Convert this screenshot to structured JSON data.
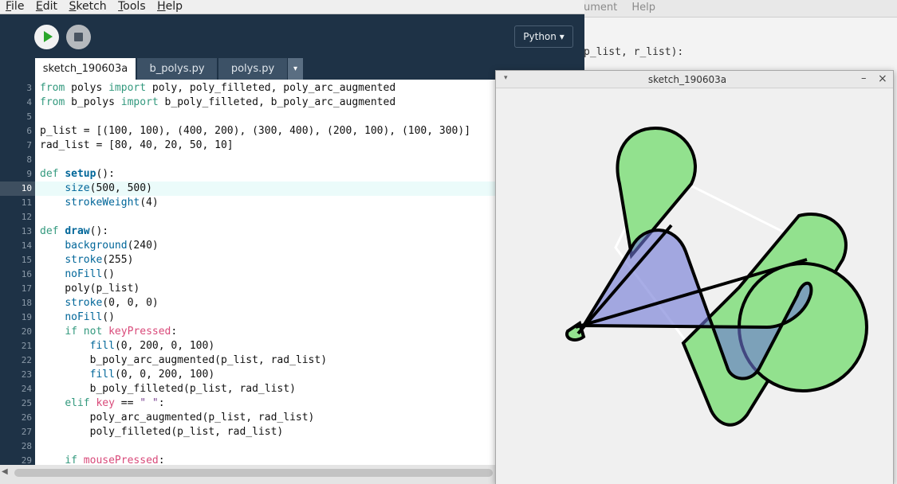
{
  "menu": {
    "file": "File",
    "edit": "Edit",
    "sketch": "Sketch",
    "tools": "Tools",
    "help": "Help"
  },
  "background_window": {
    "menu_items": [
      "ument",
      "Help"
    ],
    "code_fragment": "p_list, r_list):"
  },
  "toolbar": {
    "run_icon": "play-icon",
    "stop_icon": "stop-icon",
    "mode_label": "Python ▾"
  },
  "tabs": {
    "items": [
      "sketch_190603a",
      "b_polys.py",
      "polys.py"
    ],
    "active": 0,
    "overflow_icon": "▾"
  },
  "editor": {
    "lines": [
      {
        "n": "3",
        "text": "from polys import poly, poly_filleted, poly_arc_augmented"
      },
      {
        "n": "4",
        "text": "from b_polys import b_poly_filleted, b_poly_arc_augmented"
      },
      {
        "n": "5",
        "text": ""
      },
      {
        "n": "6",
        "text": "p_list = [(100, 100), (400, 200), (300, 400), (200, 100), (100, 300)]"
      },
      {
        "n": "7",
        "text": "rad_list = [80, 40, 20, 50, 10]"
      },
      {
        "n": "8",
        "text": ""
      },
      {
        "n": "9",
        "text": "def setup():"
      },
      {
        "n": "10",
        "text": "    size(500, 500)"
      },
      {
        "n": "11",
        "text": "    strokeWeight(4)"
      },
      {
        "n": "12",
        "text": ""
      },
      {
        "n": "13",
        "text": "def draw():"
      },
      {
        "n": "14",
        "text": "    background(240)"
      },
      {
        "n": "15",
        "text": "    stroke(255)"
      },
      {
        "n": "16",
        "text": "    noFill()"
      },
      {
        "n": "17",
        "text": "    poly(p_list)"
      },
      {
        "n": "18",
        "text": "    stroke(0, 0, 0)"
      },
      {
        "n": "19",
        "text": "    noFill()"
      },
      {
        "n": "20",
        "text": "    if not keyPressed:"
      },
      {
        "n": "21",
        "text": "        fill(0, 200, 0, 100)"
      },
      {
        "n": "22",
        "text": "        b_poly_arc_augmented(p_list, rad_list)"
      },
      {
        "n": "23",
        "text": "        fill(0, 0, 200, 100)"
      },
      {
        "n": "24",
        "text": "        b_poly_filleted(p_list, rad_list)"
      },
      {
        "n": "25",
        "text": "    elif key == \" \":"
      },
      {
        "n": "26",
        "text": "        poly_arc_augmented(p_list, rad_list)"
      },
      {
        "n": "27",
        "text": "        poly_filleted(p_list, rad_list)"
      },
      {
        "n": "28",
        "text": ""
      },
      {
        "n": "29",
        "text": "    if mousePressed:"
      }
    ],
    "highlighted_line": "10"
  },
  "sketch_window": {
    "title": "sketch_190603a",
    "menu_icon": "▾",
    "minimize_icon": "–",
    "close_icon": "×"
  },
  "colors": {
    "green_fill": "#92e18e",
    "blue_fill": "#9c9ae6",
    "overlap_fill": "#527da2",
    "editor_bg": "#1e3246"
  }
}
